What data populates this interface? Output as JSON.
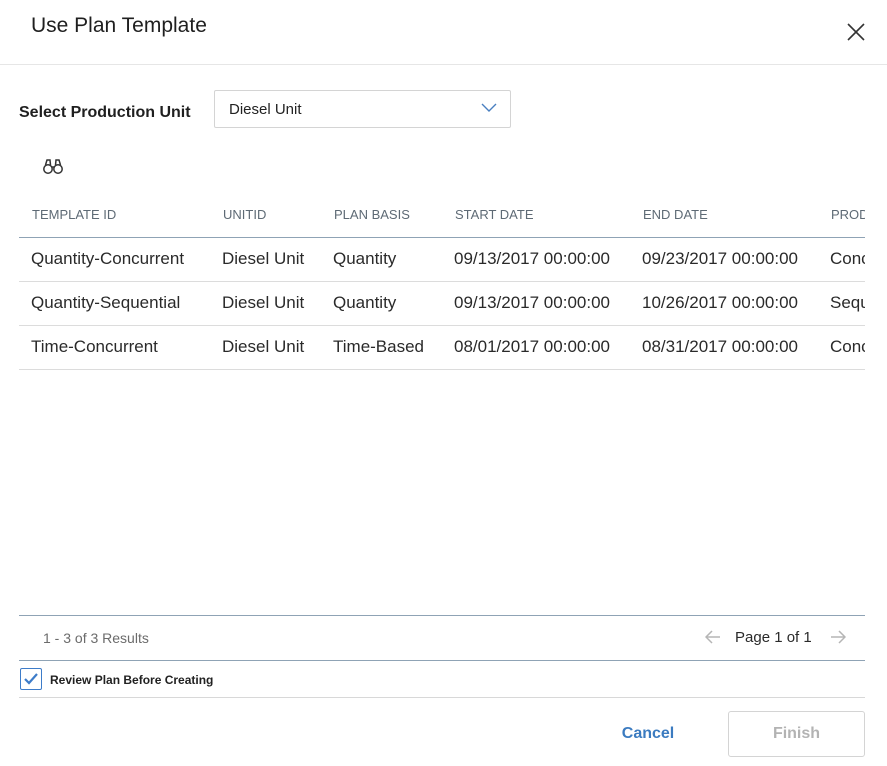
{
  "dialog": {
    "title": "Use Plan Template",
    "unit_label": "Select Production Unit",
    "unit_selected": "Diesel Unit"
  },
  "table": {
    "columns": [
      "TEMPLATE ID",
      "UNITID",
      "PLAN BASIS",
      "START DATE",
      "END DATE",
      "PROD"
    ],
    "rows": [
      [
        "Quantity-Concurrent",
        "Diesel Unit",
        "Quantity",
        "09/13/2017 00:00:00",
        "09/23/2017 00:00:00",
        "Conc"
      ],
      [
        "Quantity-Sequential",
        "Diesel Unit",
        "Quantity",
        "09/13/2017 00:00:00",
        "10/26/2017 00:00:00",
        "Sequ"
      ],
      [
        "Time-Concurrent",
        "Diesel Unit",
        "Time-Based",
        "08/01/2017 00:00:00",
        "08/31/2017 00:00:00",
        "Conc"
      ]
    ]
  },
  "pager": {
    "results": "1 - 3 of 3 Results",
    "page_info": "Page 1 of 1"
  },
  "review": {
    "label": "Review Plan Before Creating",
    "checked": true
  },
  "buttons": {
    "cancel": "Cancel",
    "finish": "Finish"
  },
  "icons": {
    "close": "close-icon",
    "dropdown": "chevron-down-icon",
    "search": "binoculars-icon",
    "prev": "arrow-left-icon",
    "next": "arrow-right-icon",
    "check": "checkmark-icon"
  },
  "colors": {
    "accent": "#3b7bc0",
    "disabled_text": "#b3b3b3",
    "header_border": "#8fa3b5"
  }
}
